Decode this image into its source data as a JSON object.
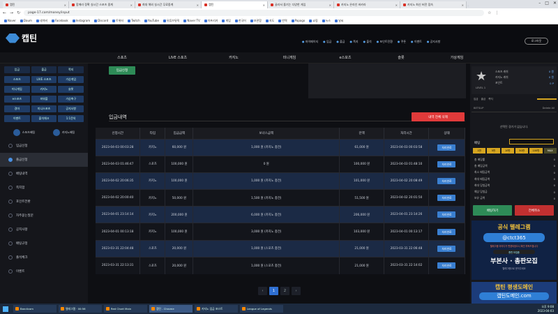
{
  "browser": {
    "tabs": [
      {
        "title": "캡틴"
      },
      {
        "title": "함께라 정확 실시간 스포츠 중계"
      },
      {
        "title": "최대 해외 실시간 무료중계"
      },
      {
        "title": "캡틴"
      },
      {
        "title": "골라서 즐기는 다양한 게임"
      },
      {
        "title": "카지노 온라인 바카라"
      },
      {
        "title": "카지노 최신 버전 접속"
      }
    ],
    "url": "page-17.com/money/input"
  },
  "bookmarks": [
    "Naver",
    "Daum",
    "네이버",
    "Facebook",
    "Instagram",
    "Discord",
    "트위터",
    "Twitch",
    "YouTube",
    "유튜브뮤직",
    "Naver TV",
    "아프리카",
    "게임",
    "한국어",
    "보관함",
    "지도",
    "번역",
    "Papago",
    "쇼핑",
    "뉴스",
    "날씨"
  ],
  "site": {
    "logo_text": "캡틴",
    "top_links": [
      "마이페이지",
      "입금",
      "출금",
      "쪽지",
      "출석",
      "포인트전환",
      "쿠폰",
      "이벤트",
      "공지사항"
    ],
    "logout": "로그아웃",
    "main_nav": [
      "스포츠",
      "LIVE 스포츠",
      "카지노",
      "미니게임",
      "e스포츠",
      "슬롯",
      "가상게임"
    ]
  },
  "left": {
    "top_row": [
      "입금",
      "출금",
      "쪽지"
    ],
    "grid": [
      "스포츠",
      "LIVE 스포츠",
      "가상게임",
      "미니게임",
      "카지노",
      "슬롯",
      "e스포츠",
      "파워볼",
      "가상축구",
      "경마",
      "미니스포츠",
      "공지사항",
      "이벤트",
      "출석체크",
      "1:1문의"
    ],
    "fav": [
      "스포츠배팅",
      "카지노배팅"
    ],
    "menu": [
      "입금신청",
      "출금신청",
      "베팅내역",
      "쪽지함",
      "포인트전환",
      "자주묻는질문",
      "공지사항",
      "배팅규정",
      "출석체크",
      "이벤트"
    ]
  },
  "content": {
    "apply_btn": "입금신청",
    "section_title": "입금내역",
    "delete_btn": "내역 전체 삭제",
    "headers": [
      "신청시간",
      "타입",
      "입금금액",
      "보너스금액",
      "잔액",
      "처리시간",
      "상태"
    ],
    "rows": [
      [
        "2023-04-03 00:03:28",
        "카지노",
        "60,000 원",
        "1,000 원 (카지노 충전)",
        "61,000 원",
        "2023-04-03 00:03:58",
        "처리완료"
      ],
      [
        "2023-04-03 01:46:47",
        "스포츠",
        "100,000 원",
        "0 원",
        "100,000 원",
        "2023-04-03 01:48:10",
        "처리완료"
      ],
      [
        "2023-04-02 20:06:35",
        "카지노",
        "100,000 원",
        "1,000 원 (카지노 충전)",
        "101,000 원",
        "2023-04-02 20:08:49",
        "처리완료"
      ],
      [
        "2023-04-02 20:00:40",
        "카지노",
        "50,000 원",
        "1,500 원 (카지노 충전)",
        "51,500 원",
        "2023-04-02 20:01:50",
        "처리완료"
      ],
      [
        "2023-04-01 23:14:14",
        "카지노",
        "200,000 원",
        "6,000 원 (카지노 충전)",
        "206,000 원",
        "2023-04-01 23:14:26",
        "처리완료"
      ],
      [
        "2023-04-01 00:13:18",
        "카지노",
        "100,000 원",
        "3,000 원 (카지노 충전)",
        "103,000 원",
        "2023-04-01 00:13:17",
        "처리완료"
      ],
      [
        "2023-03-31 22:04:48",
        "스포츠",
        "20,000 원",
        "1,000 원 (스포츠 충전)",
        "21,000 원",
        "2023-03-31 22:06:48",
        "처리완료"
      ],
      [
        "2023-03-31 22:13:31",
        "스포츠",
        "20,000 원",
        "1,000 원 (스포츠 충전)",
        "21,000 원",
        "2023-03-31 22:14:02",
        "처리완료"
      ]
    ],
    "pages": [
      "‹",
      "1",
      "2",
      "›"
    ],
    "current_page": "1"
  },
  "right": {
    "level": "LEVEL 1",
    "user_rows": [
      [
        "스포츠 캐쉬",
        "0 원"
      ],
      [
        "카지노 캐쉬",
        "0 원"
      ],
      [
        "포인트",
        "0 P"
      ]
    ],
    "msg_tabs": [
      "입금",
      "출금",
      "쪽지"
    ],
    "notice_head": [
      "BETSLIP",
      "Delete All"
    ],
    "notice_empty": "선택된 경기가 없습니다.",
    "bet_label": "배팅",
    "amounts": [
      "1만",
      "5만",
      "10만",
      "50만",
      "100만",
      "MAX"
    ],
    "slip_rows": [
      [
        "총 배당률",
        "0"
      ],
      [
        "총 배당금액",
        "0"
      ],
      [
        "최소 배팅금액",
        "0"
      ],
      [
        "최대 배팅금액",
        "0"
      ],
      [
        "최대 당첨금액",
        "0"
      ],
      [
        "예상 당첨금",
        "0"
      ],
      [
        "보유 금액",
        "0"
      ]
    ],
    "bet_btn": "배팅하기",
    "reset_btn": "전체취소",
    "banner1": {
      "title": "공식 텔레그램",
      "handle": "@ctct365",
      "sub": "텔레그램 아이디가 변경되었으니 확인 부탁드립니다",
      "recruit": "총판 모집중",
      "big": "부본사 · 총판모집",
      "note": "텔레그램으로 문의주세요"
    },
    "banner2": {
      "title": "캡틴 평생도메인",
      "url": "캡틴도메인.com"
    }
  },
  "taskbar": {
    "items": [
      "Bandicam",
      "텔레그램 · 00:56",
      "Red Chart Main",
      "캡틴 - Chrome",
      "카지노 입금 포스트",
      "League of Legends"
    ],
    "active": 3,
    "time": "오후 9:08",
    "date": "2023-04-03"
  }
}
